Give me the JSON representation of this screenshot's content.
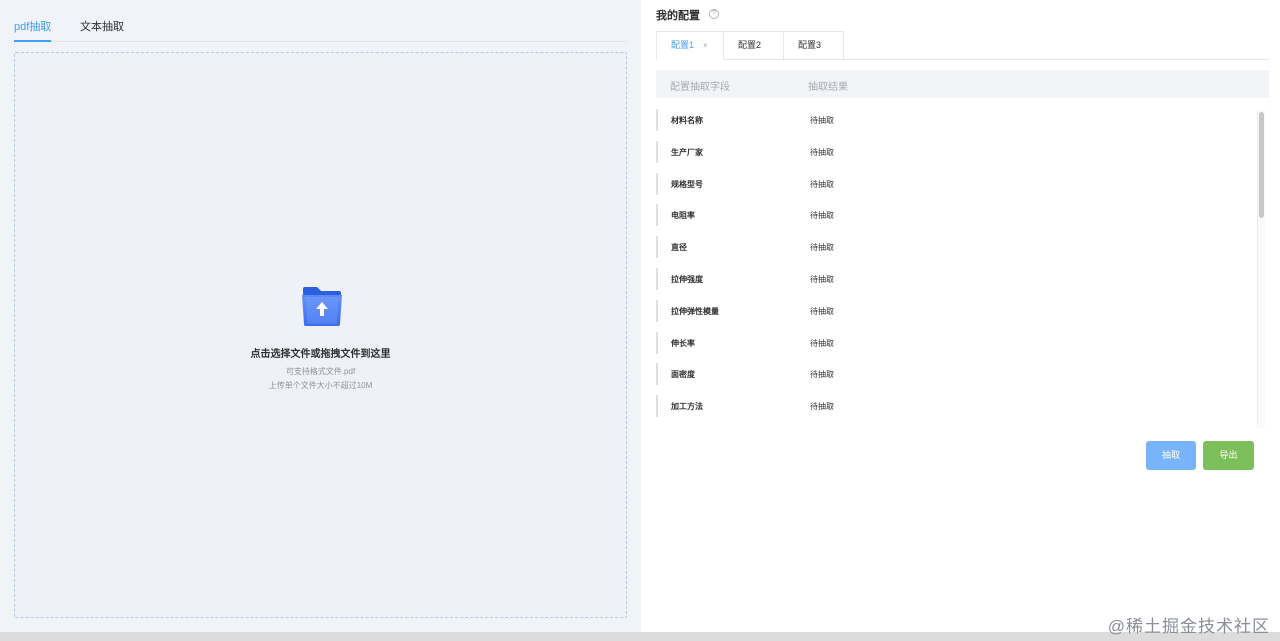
{
  "left": {
    "tabs": [
      {
        "label": "pdf抽取",
        "active": true
      },
      {
        "label": "文本抽取",
        "active": false
      }
    ],
    "upload": {
      "title": "点击选择文件或拖拽文件到这里",
      "hint_format": "可支持格式文件.pdf",
      "hint_size": "上传单个文件大小不超过10M",
      "icon": "folder-upload-icon"
    }
  },
  "right": {
    "title": "我的配置",
    "help_icon": "question-circle-icon",
    "tabs": [
      {
        "label": "配置1",
        "active": true,
        "closable": true,
        "close": "×"
      },
      {
        "label": "配置2",
        "active": false
      },
      {
        "label": "配置3",
        "active": false
      }
    ],
    "table": {
      "headers": [
        "配置抽取字段",
        "抽取结果"
      ],
      "rows": [
        {
          "field": "材料名称",
          "result": "待抽取"
        },
        {
          "field": "生产厂家",
          "result": "待抽取"
        },
        {
          "field": "规格型号",
          "result": "待抽取"
        },
        {
          "field": "电阻率",
          "result": "待抽取"
        },
        {
          "field": "直径",
          "result": "待抽取"
        },
        {
          "field": "拉伸强度",
          "result": "待抽取"
        },
        {
          "field": "拉伸弹性模量",
          "result": "待抽取"
        },
        {
          "field": "伸长率",
          "result": "待抽取"
        },
        {
          "field": "面密度",
          "result": "待抽取"
        },
        {
          "field": "加工方法",
          "result": "待抽取"
        }
      ]
    },
    "buttons": {
      "extract": "抽取",
      "export": "导出"
    }
  },
  "colors": {
    "accent": "#409eff",
    "extract_button": "#79b4fb",
    "export_button": "#7cbf5a",
    "dropzone_bg": "#eef2f8"
  },
  "watermark": "@稀土掘金技术社区"
}
